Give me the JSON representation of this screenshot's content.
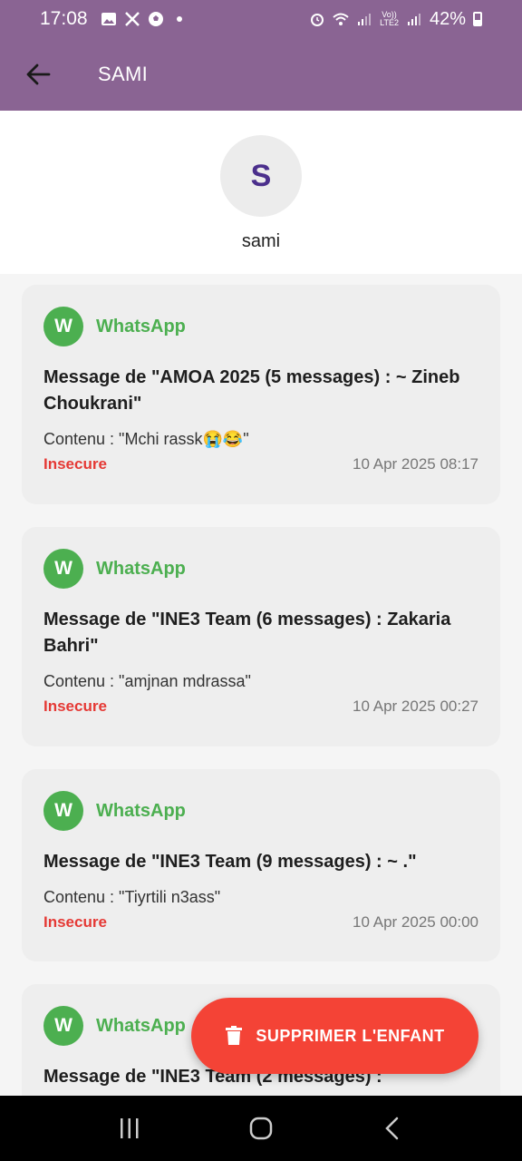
{
  "status_bar": {
    "time": "17:08",
    "network_label": "Vo))\nLTE2",
    "battery": "42%",
    "icons": [
      "gallery-icon",
      "x-icon",
      "soccer-ball-icon",
      "dot-icon",
      "alarm-icon",
      "wifi-icon",
      "signal-icon",
      "battery-icon"
    ]
  },
  "appbar": {
    "title": "SAMI",
    "back_icon": "arrow-left-icon"
  },
  "profile": {
    "initial": "S",
    "name": "sami"
  },
  "messages": [
    {
      "app_initial": "W",
      "app_name": "WhatsApp",
      "title": "Message de \"AMOA 2025 (5 messages) : ~ Zineb Choukrani\"",
      "content": "Contenu : \"Mchi rassk😭😂\"",
      "status": "Insecure",
      "date": "10 Apr 2025 08:17"
    },
    {
      "app_initial": "W",
      "app_name": "WhatsApp",
      "title": "Message de \"INE3 Team (6 messages) : Zakaria Bahri\"",
      "content": "Contenu : \"amjnan mdrassa\"",
      "status": "Insecure",
      "date": "10 Apr 2025 00:27"
    },
    {
      "app_initial": "W",
      "app_name": "WhatsApp",
      "title": "Message de \"INE3 Team (9 messages) : ~ .\"",
      "content": "Contenu : \"Tiyrtili n3ass\"",
      "status": "Insecure",
      "date": "10 Apr 2025 00:00"
    },
    {
      "app_initial": "W",
      "app_name": "WhatsApp",
      "title": "Message de \"INE3 Team (2 messages) :",
      "content": "",
      "status": "",
      "date": ""
    }
  ],
  "fab": {
    "label": "SUPPRIMER L'ENFANT",
    "icon": "trash-icon"
  },
  "colors": {
    "appbar": "#8a6493",
    "whatsapp_green": "#4caf50",
    "insecure_red": "#e53935",
    "fab_red": "#f44336",
    "avatar_text": "#4b2f8c"
  }
}
